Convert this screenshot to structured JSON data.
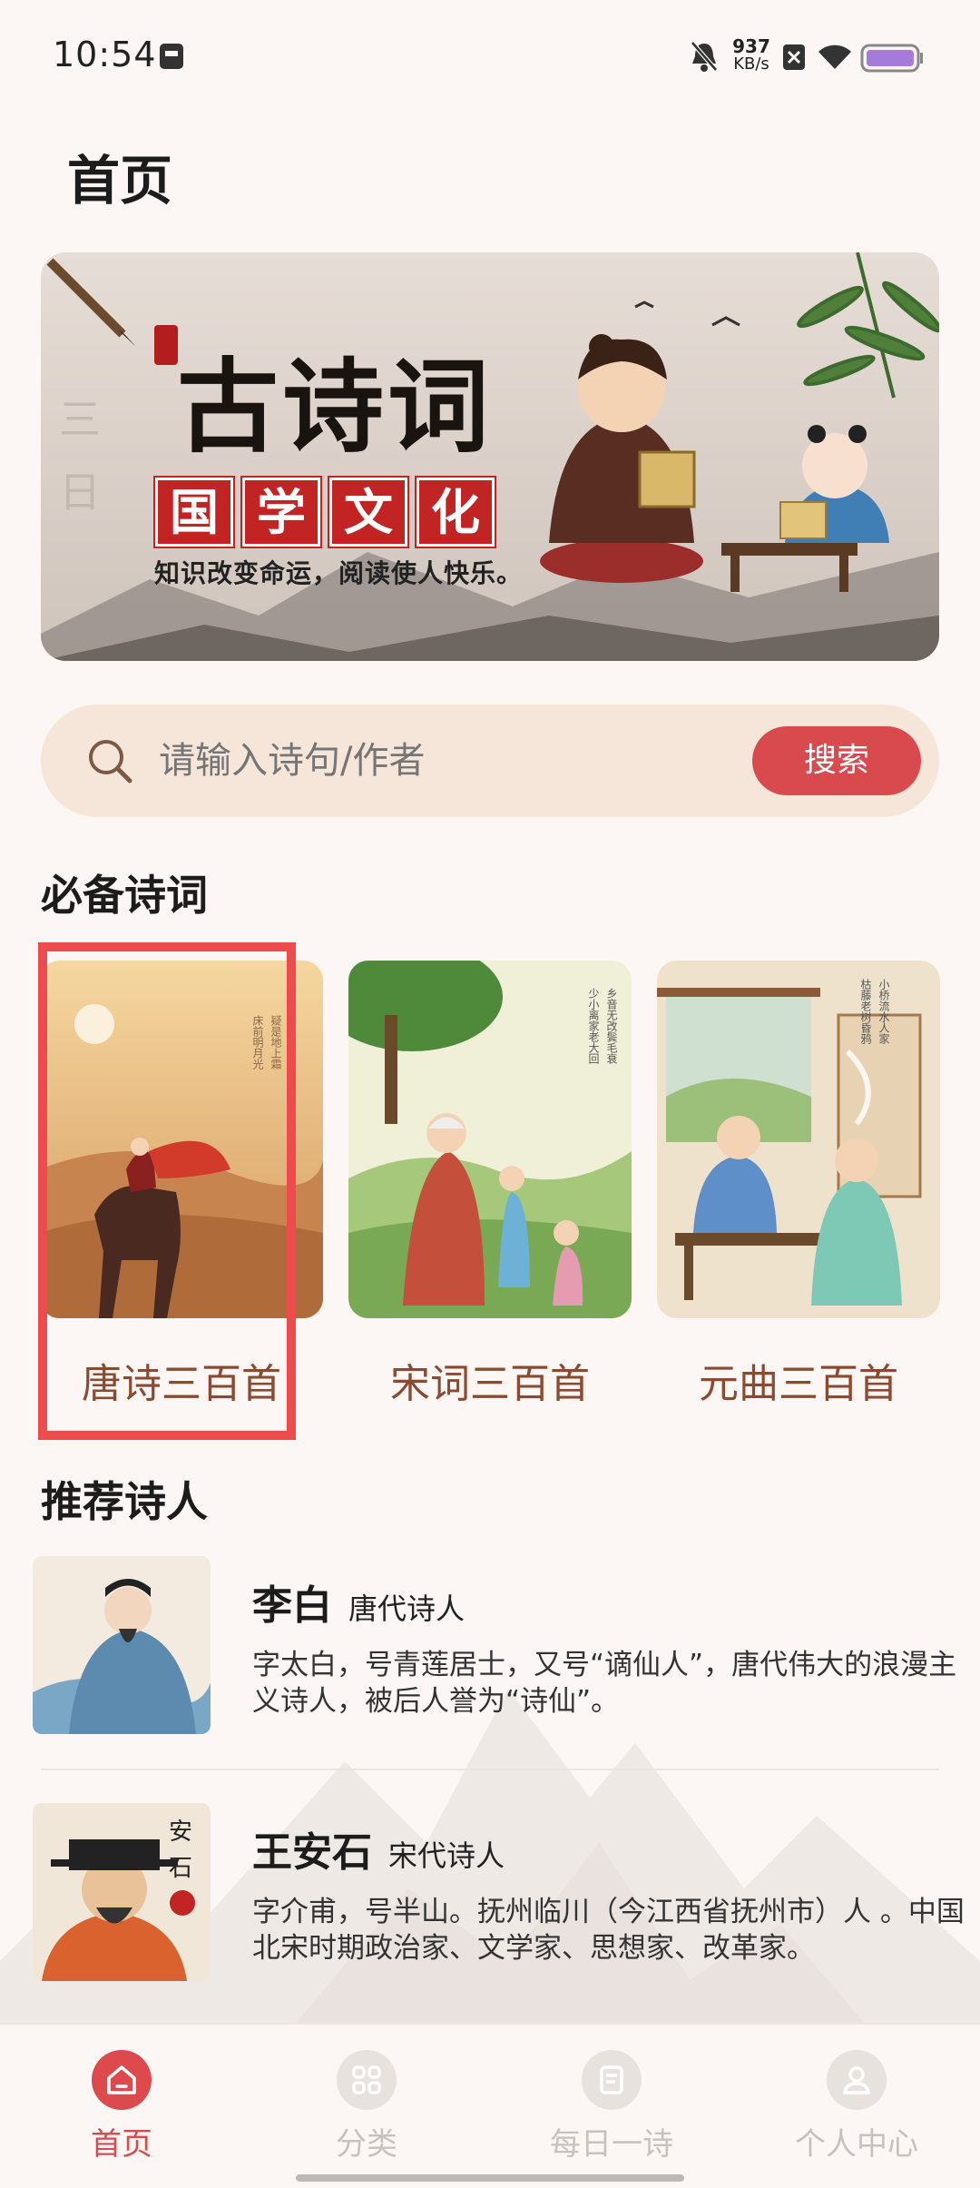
{
  "status_bar": {
    "time": "10:54",
    "net_speed_value": "937",
    "net_speed_unit": "KB/s",
    "icons": [
      "storage-icon",
      "mute-icon",
      "sim-off-icon",
      "wifi-icon",
      "battery-icon"
    ]
  },
  "page_title": "首页",
  "banner": {
    "title": "古诗词",
    "subtitle_chars": [
      "国",
      "学",
      "文",
      "化"
    ],
    "slogan": "知识改变命运，阅读使人快乐。"
  },
  "search": {
    "placeholder": "请输入诗句/作者",
    "button_label": "搜索"
  },
  "section_must_read": {
    "title": "必备诗词",
    "cards": [
      {
        "label": "唐诗三百首"
      },
      {
        "label": "宋词三百首"
      },
      {
        "label": "元曲三百首"
      }
    ]
  },
  "section_poets": {
    "title": "推荐诗人",
    "poets": [
      {
        "name": "李白",
        "era": "唐代诗人",
        "desc": "字太白，号青莲居士，又号“谪仙人”，唐代伟大的浪漫主义诗人，被后人誉为“诗仙”。"
      },
      {
        "name": "王安石",
        "era": "宋代诗人",
        "desc": "字介甫，号半山。抚州临川（今江西省抚州市）人 。中国北宋时期政治家、文学家、思想家、改革家。"
      }
    ]
  },
  "bottom_nav": {
    "items": [
      {
        "label": "首页",
        "icon": "home-icon",
        "active": true
      },
      {
        "label": "分类",
        "icon": "grid-icon",
        "active": false
      },
      {
        "label": "每日一诗",
        "icon": "document-icon",
        "active": false
      },
      {
        "label": "个人中心",
        "icon": "user-icon",
        "active": false
      }
    ]
  },
  "colors": {
    "accent": "#d94a4f",
    "background": "#fcf7f4",
    "card_label": "#8b4a2f",
    "highlight_box": "#ee4c4c"
  }
}
